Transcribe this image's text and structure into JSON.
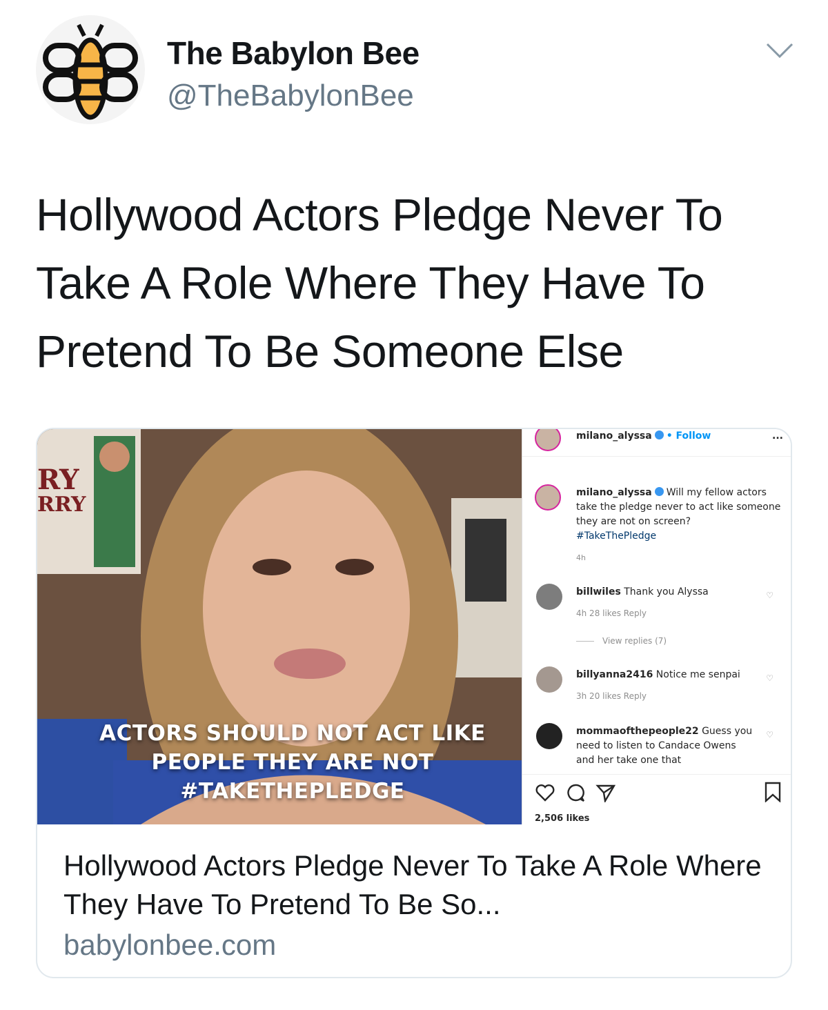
{
  "tweet": {
    "display_name": "The Babylon Bee",
    "handle": "@TheBabylonBee",
    "text": "Hollywood Actors Pledge Never To Take A Role Where They Have To Pretend To Be Someone Else"
  },
  "card": {
    "title": "Hollywood Actors Pledge Never To Take A Role Where They Have To Pretend To Be So...",
    "domain": "babylonbee.com",
    "video": {
      "wall_text": [
        "RY",
        "RRY"
      ],
      "caption_lines": [
        "ACTORS SHOULD NOT ACT LIKE",
        "PEOPLE THEY ARE NOT",
        "#TAKETHEPLEDGE"
      ]
    },
    "instagram": {
      "top_user": "milano_alyssa",
      "separator": "•",
      "follow_label": "Follow",
      "more_label": "...",
      "post_user": "milano_alyssa",
      "post_text": "Will my fellow actors take the pledge never to act like someone they are not on screen?",
      "post_tag": "#TakeThePledge",
      "post_time": "4h",
      "comments": [
        {
          "user": "billwiles",
          "text": "Thank you Alyssa",
          "meta": "4h   28 likes   Reply",
          "replies": "View replies (7)"
        },
        {
          "user": "billyanna2416",
          "text": "Notice me senpai",
          "meta": "3h   20 likes   Reply"
        },
        {
          "user": "mommaofthepeople22",
          "text": "Guess you need to listen to Candace Owens and her take one that"
        }
      ],
      "likes": "2,506 likes"
    }
  },
  "colors": {
    "text": "#14171a",
    "secondary": "#657786",
    "border": "#e1e8ed",
    "bee_yellow": "#f7b548",
    "ig_blue": "#0095f6"
  },
  "icons": [
    "bee-logo-icon",
    "chevron-down-icon",
    "heart-icon",
    "comment-icon",
    "share-icon",
    "bookmark-icon",
    "verified-icon"
  ]
}
